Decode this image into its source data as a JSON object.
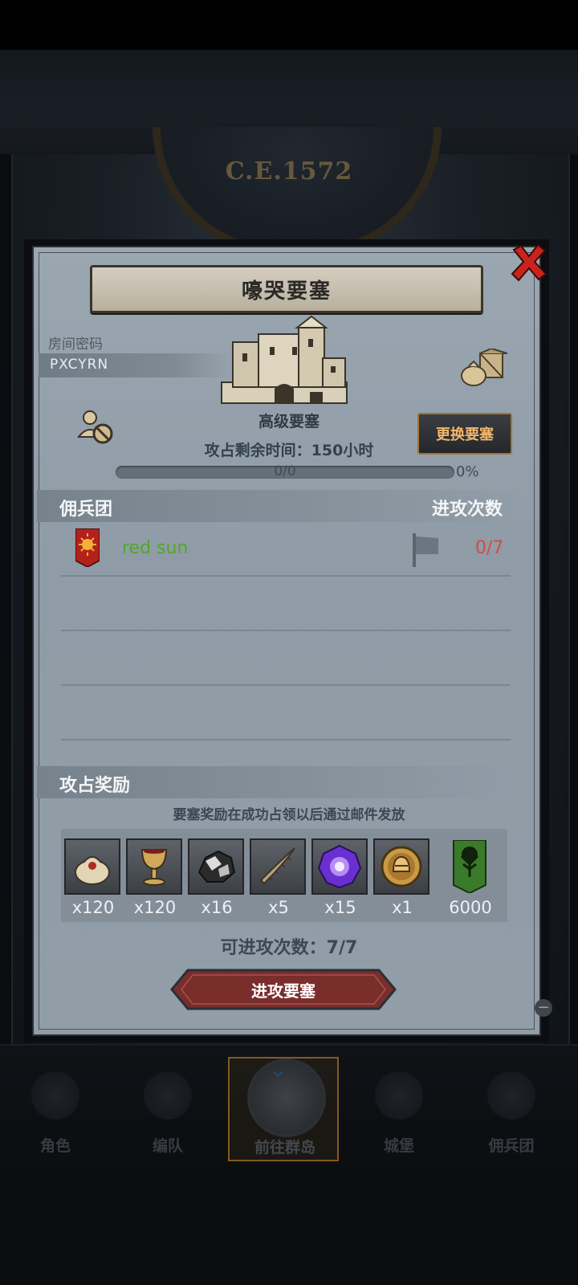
{
  "era": {
    "label": "C.E.1572"
  },
  "dialog": {
    "title": "嚎哭要塞",
    "room_password_label": "房间密码",
    "room_password_value": "PXCYRN",
    "fortress_name": "高级要塞",
    "change_button": "更换要塞",
    "remaining_time": "攻占剩余时间：150小时",
    "progress": {
      "text": "0/0",
      "percent_text": "0%",
      "value": 0
    },
    "mercenary_header": "佣兵团",
    "attacks_header": "进攻次数",
    "mercenaries": [
      {
        "name": "red sun",
        "attacks": "0/7"
      }
    ],
    "rewards_header": "攻占奖励",
    "reward_note": "要塞奖励在成功占领以后通过邮件发放",
    "rewards": [
      {
        "icon": "coin-bag-icon",
        "qty": "x120"
      },
      {
        "icon": "goblet-icon",
        "qty": "x120"
      },
      {
        "icon": "ore-icon",
        "qty": "x16"
      },
      {
        "icon": "horn-icon",
        "qty": "x5"
      },
      {
        "icon": "purple-gem-icon",
        "qty": "x15"
      },
      {
        "icon": "helmet-medal-icon",
        "qty": "x1"
      },
      {
        "icon": "tree-banner-icon",
        "qty": "6000"
      }
    ],
    "attempts_left": "可进攻次数：7/7",
    "attack_button": "进攻要塞"
  },
  "nav": {
    "items": [
      {
        "label": "角色"
      },
      {
        "label": "编队"
      },
      {
        "label": "前往群岛"
      },
      {
        "label": "城堡"
      },
      {
        "label": "佣兵团"
      }
    ],
    "active_index": 2
  },
  "colors": {
    "panel": "#919da7",
    "accent_gold": "#d9a04a",
    "mercenary_name": "#55a52f",
    "attack_count": "#d14c48",
    "attack_button": "#7a2e2c",
    "change_button_text": "#f3b66b"
  }
}
